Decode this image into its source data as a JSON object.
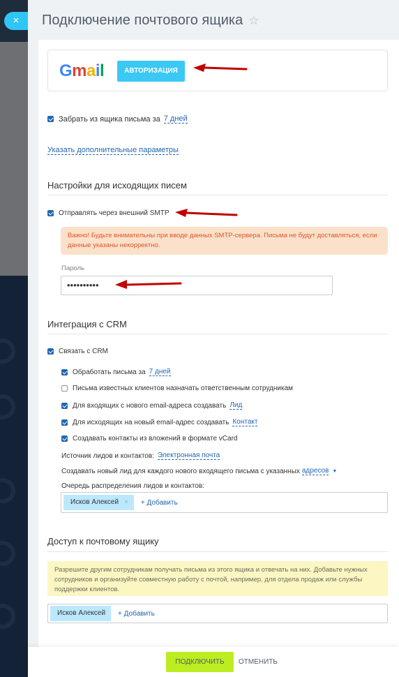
{
  "header": {
    "title": "Подключение почтового ящика",
    "close_icon": "×",
    "star_icon": "☆"
  },
  "gmail": {
    "logo": {
      "g": "G",
      "m": "m",
      "a": "a",
      "i": "i",
      "l": "l"
    },
    "auth_button": "АВТОРИЗАЦИЯ"
  },
  "fetch": {
    "label": "Забрать из ящика письма за",
    "period": "7 дней",
    "checked": true
  },
  "extra_params_link": "Указать дополнительные параметры",
  "outgoing": {
    "title": "Настройки для исходящих писем",
    "smtp_label": "Отправлять через внешний SMTP",
    "smtp_checked": true,
    "warning": "Важно! Будьте внимательны при вводе данных SMTP-сервера. Письма не будут доставляться, если данные указаны некорректно.",
    "password_label": "Пароль",
    "password_value": "••••••••••"
  },
  "crm": {
    "title": "Интеграция с CRM",
    "link_label": "Связать с CRM",
    "options": [
      {
        "label": "Обработать письма за",
        "link": "7 дней",
        "checked": true
      },
      {
        "label": "Письма известных клиентов назначать ответственным сотрудникам",
        "link": "",
        "checked": false
      },
      {
        "label": "Для входящих с нового email-адреса создавать",
        "link": "Лид",
        "checked": true
      },
      {
        "label": "Для исходящих на новый email-адрес создавать",
        "link": "Контакт",
        "checked": true
      },
      {
        "label": "Создавать контакты из вложений в формате vCard",
        "link": "",
        "checked": true
      }
    ],
    "source_label": "Источник лидов и контактов:",
    "source_value": "Электронная почта",
    "new_lead_label": "Создавать новый лид для каждого нового входящего письма с указанных",
    "new_lead_link": "адресов",
    "queue_label": "Очередь распределения лидов и контактов:",
    "queue_user": "Исков Алексей",
    "queue_remove": "×",
    "add_label": "+ Добавить"
  },
  "access": {
    "title": "Доступ к почтовому ящику",
    "info": "Разрешите другим сотрудникам получать письма из этого ящика и отвечать на них. Добавьте нужных сотрудников и организуйте совместную работу с почтой, например, для отдела продаж или службы поддержки клиентов.",
    "user": "Исков Алексей",
    "add_label": "+ Добавить"
  },
  "footer": {
    "connect": "ПОДКЛЮЧИТЬ",
    "cancel": "ОТМЕНИТЬ"
  },
  "colors": {
    "accent": "#2fc6f6",
    "link": "#2067b0",
    "connect": "#bbed21",
    "arrow": "#c00000"
  }
}
